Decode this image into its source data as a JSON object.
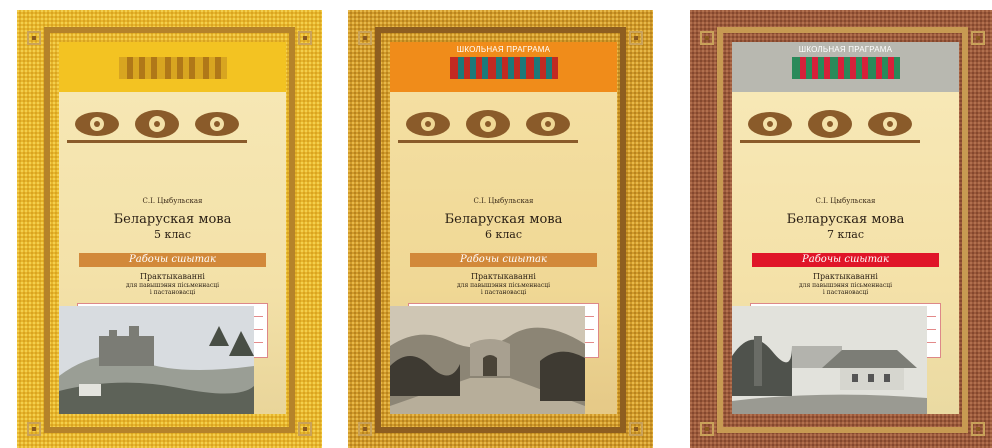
{
  "covers": [
    {
      "logo_text": "",
      "author": "С.І. Цыбульская",
      "title": "Беларуская мова",
      "grade": "5 клас",
      "notebook": "Рабочы сшытак",
      "subtitle": "Практыкаванні",
      "purpose_line1": "для павышэння пісьменнасці",
      "purpose_line2": "і пастановасці",
      "colors": {
        "border": "#e8b830",
        "band": "#f3c322",
        "bar": "#d2893a",
        "page": "#f3e1a8"
      }
    },
    {
      "logo_text": "ШКОЛЬНАЯ ПРАГРАМА",
      "author": "С.І. Цыбульская",
      "title": "Беларуская мова",
      "grade": "6 клас",
      "notebook": "Рабочы сшытак",
      "subtitle": "Практыкаванні",
      "purpose_line1": "для павышэння пісьменнасці",
      "purpose_line2": "і пастановасці",
      "colors": {
        "border": "#d39e2c",
        "band": "#f08c1a",
        "bar": "#d2893a",
        "page": "#f0d895"
      }
    },
    {
      "logo_text": "ШКОЛЬНАЯ ПРАГРАМА",
      "author": "С.І. Цыбульская",
      "title": "Беларуская мова",
      "grade": "7 клас",
      "notebook": "Рабочы сшытак",
      "subtitle": "Практыкаванні",
      "purpose_line1": "для павышэння пісьменнасці",
      "purpose_line2": "і пастановасці",
      "colors": {
        "border": "#9c5a3c",
        "band": "#b8b8b0",
        "bar": "#e01528",
        "page": "#f4e1a8"
      }
    }
  ]
}
